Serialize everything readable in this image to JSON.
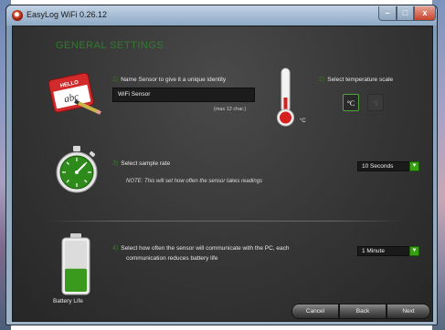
{
  "window": {
    "title": "EasyLog WiFi 0.26.12",
    "controls": {
      "minimize": "–",
      "maximize": "□",
      "close": "x"
    }
  },
  "heading": "GENERAL SETTINGS",
  "steps": {
    "name": {
      "number": "1)",
      "label": "Name Sensor to give it a unique identity",
      "value": "WiFi Sensor",
      "hint": "(max 12 char.)",
      "icon": "name-tag-icon",
      "tag_text": {
        "top": "HELLO",
        "bottom": "abc"
      }
    },
    "scale": {
      "number": "2)",
      "label": "Select temperature scale",
      "celsius": "°C",
      "fahrenheit": "°F",
      "selected": "°C",
      "icon": "thermometer-icon",
      "unit_text": "°C"
    },
    "rate": {
      "number": "3)",
      "label": "Select sample rate",
      "note": "NOTE: This will set how often the sensor takes readings",
      "selected": "10 Seconds",
      "icon": "stopwatch-icon"
    },
    "comm": {
      "number": "4)",
      "label_line1": "Select how often the sensor will communicate with the PC, each",
      "label_line2": "communication reduces battery life",
      "selected": "1 Minute",
      "icon": "battery-icon",
      "battery_label": "Battery Life",
      "battery_level": 0.45
    }
  },
  "buttons": {
    "cancel": "Cancel",
    "back": "Back",
    "next": "Next"
  },
  "colors": {
    "accent": "#35a10f",
    "step_number": "#3a7a22",
    "heading": "#2f7d2c",
    "background": "#353535"
  }
}
